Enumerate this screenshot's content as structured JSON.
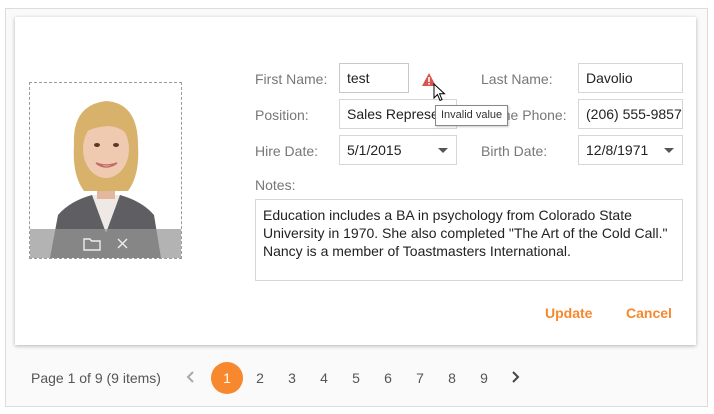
{
  "form": {
    "first_name_label": "First Name:",
    "first_name_value": "test",
    "last_name_label": "Last Name:",
    "last_name_value": "Davolio",
    "position_label": "Position:",
    "position_value": "Sales Representative",
    "phone_label": "Home Phone:",
    "phone_value": "(206) 555-9857",
    "hire_date_label": "Hire Date:",
    "hire_date_value": "5/1/2015",
    "birth_date_label": "Birth Date:",
    "birth_date_value": "12/8/1971",
    "notes_label": "Notes:",
    "notes_lines": [
      "Education includes a BA in psychology from Colorado State",
      "University in 1970.  She also completed \"The Art of the Cold Call.\"",
      "Nancy is a member of Toastmasters International."
    ],
    "tooltip": "Invalid value"
  },
  "actions": {
    "update": "Update",
    "cancel": "Cancel"
  },
  "pager": {
    "info": "Page 1 of 9 (9 items)",
    "pages": [
      "1",
      "2",
      "3",
      "4",
      "5",
      "6",
      "7",
      "8",
      "9"
    ],
    "current_page": "1"
  },
  "icons": {
    "photo_folder": "folder-icon",
    "photo_remove": "close-icon",
    "validation": "warning-icon",
    "prev": "chevron-left-icon",
    "next": "chevron-right-icon"
  },
  "colors": {
    "accent": "#f7882d",
    "warning": "#d9534f"
  }
}
